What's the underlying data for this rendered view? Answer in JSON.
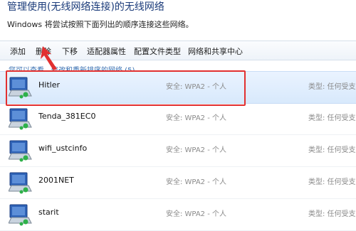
{
  "header": {
    "title": "管理使用(无线网络连接)的无线网络",
    "subtitle": "Windows 将尝试按照下面列出的顺序连接这些网络。"
  },
  "toolbar": {
    "items": [
      "添加",
      "删除",
      "下移",
      "适配器属性",
      "配置文件类型",
      "网络和共享中心"
    ]
  },
  "hint": "您可以查看、修改和重新排序的网络 (5)",
  "networks": [
    {
      "name": "Hitler",
      "security": "安全: WPA2 - 个人",
      "type": "类型: 任何受支",
      "selected": true
    },
    {
      "name": "Tenda_381EC0",
      "security": "安全: WPA2 - 个人",
      "type": "类型: 任何受支",
      "selected": false
    },
    {
      "name": "wifi_ustcinfo",
      "security": "安全: WPA2 - 个人",
      "type": "类型: 任何受支",
      "selected": false
    },
    {
      "name": "2001NET",
      "security": "安全: WPA2 - 个人",
      "type": "类型: 任何受支",
      "selected": false
    },
    {
      "name": "starit",
      "security": "安全: WPA2 - 个人",
      "type": "类型: 任何受支",
      "selected": false
    }
  ],
  "colors": {
    "annotation": "#e23030",
    "selection": "#d8e9fc",
    "title": "#1b3b7a"
  },
  "icons": {
    "network": "wireless-network-icon",
    "annotation_arrow": "red-arrow-icon"
  }
}
